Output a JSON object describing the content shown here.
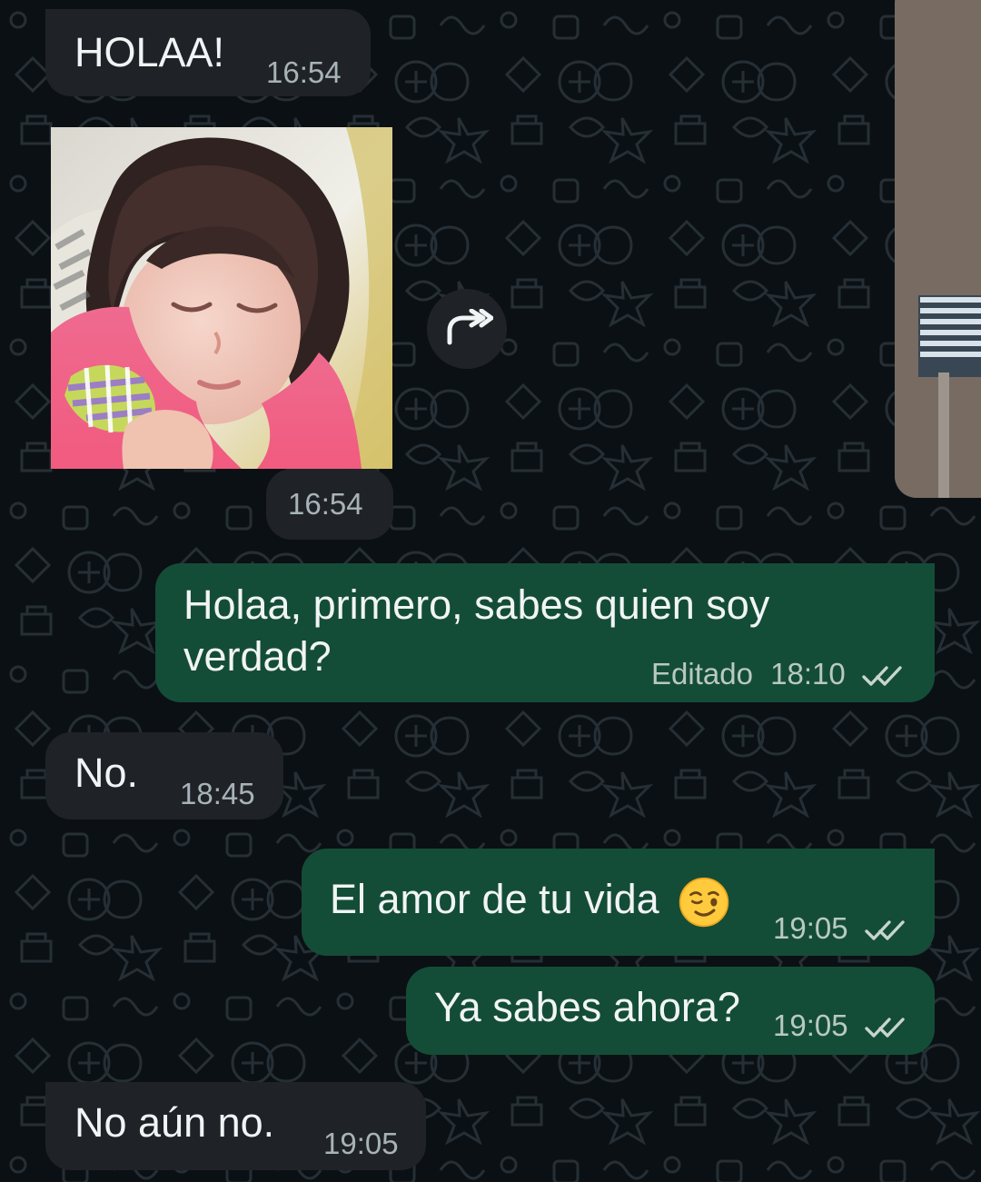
{
  "messages": [
    {
      "direction": "incoming",
      "text": "HOLAA!",
      "time": "16:54"
    },
    {
      "direction": "incoming",
      "type": "image",
      "time": "16:54",
      "image_description": "child sleeping in pink shirt"
    },
    {
      "direction": "outgoing",
      "text_line1": "Holaa, primero, sabes quien soy",
      "text_line2": "verdad?",
      "edited_label": "Editado",
      "time": "18:10",
      "status": "read"
    },
    {
      "direction": "incoming",
      "text": "No.",
      "time": "18:45"
    },
    {
      "direction": "outgoing",
      "text": "El amor de tu vida",
      "emoji": "winking-face",
      "time": "19:05",
      "status": "read"
    },
    {
      "direction": "outgoing",
      "text": "Ya sabes ahora?",
      "time": "19:05",
      "status": "read"
    },
    {
      "direction": "incoming",
      "text": "No aún no.",
      "time": "19:05"
    }
  ],
  "icons": {
    "forward": "forward-icon",
    "read_receipt": "double-check-icon",
    "emoji": "winking-face-emoji"
  },
  "colors": {
    "background": "#0b1014",
    "incoming_bubble": "#1f2328",
    "outgoing_bubble": "#144d37",
    "text": "#f1f4f5",
    "meta": "#a8b3b8"
  }
}
